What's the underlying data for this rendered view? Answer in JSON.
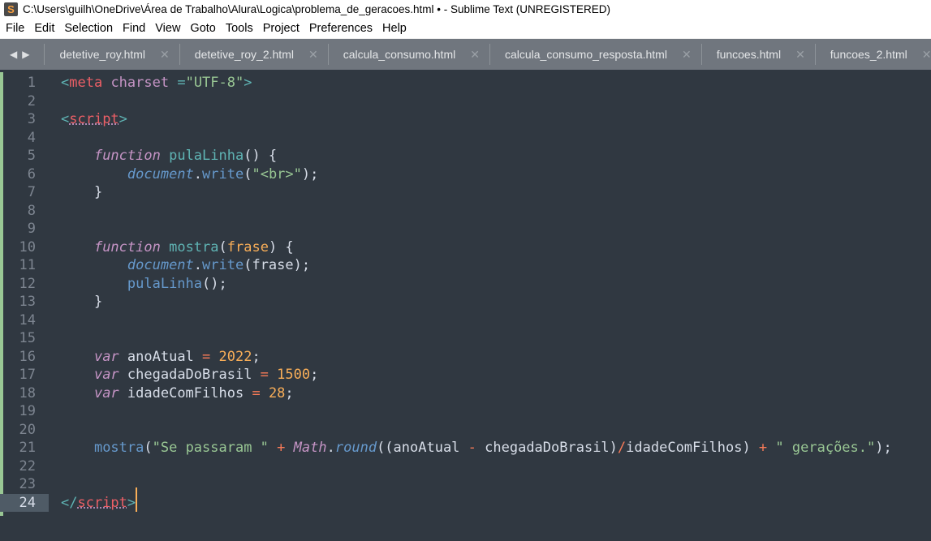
{
  "window": {
    "title": "C:\\Users\\guilh\\OneDrive\\Área de Trabalho\\Alura\\Logica\\problema_de_geracoes.html • - Sublime Text (UNREGISTERED)"
  },
  "menu": [
    "File",
    "Edit",
    "Selection",
    "Find",
    "View",
    "Goto",
    "Tools",
    "Project",
    "Preferences",
    "Help"
  ],
  "tabs": [
    "detetive_roy.html",
    "detetive_roy_2.html",
    "calcula_consumo.html",
    "calcula_consumo_resposta.html",
    "funcoes.html",
    "funcoes_2.html",
    "faz_p"
  ],
  "colors": {
    "background": "#303841",
    "tag": "#ec5f66",
    "string": "#99c794",
    "keyword": "#c594c5",
    "number": "#f9ae58",
    "caret": "#f9ae58"
  },
  "current_line": 24,
  "code": [
    [
      [
        "pu",
        "<"
      ],
      [
        "tg",
        "meta"
      ],
      [
        "",
        ""
      ],
      [
        "at",
        " charset"
      ],
      [
        "pu",
        " ="
      ],
      [
        "st",
        "\"UTF-8\""
      ],
      [
        "pu",
        ">"
      ]
    ],
    [],
    [
      [
        "pu",
        "<"
      ],
      [
        "tg ul",
        "script"
      ],
      [
        "pu",
        ">"
      ]
    ],
    [],
    [
      [
        "",
        "    "
      ],
      [
        "kw",
        "function"
      ],
      [
        "",
        " "
      ],
      [
        "fn",
        "pulaLinha"
      ],
      [
        "",
        "() {"
      ]
    ],
    [
      [
        "",
        "        "
      ],
      [
        "it",
        "document"
      ],
      [
        "",
        "."
      ],
      [
        "cl",
        "write"
      ],
      [
        "",
        "("
      ],
      [
        "st",
        "\"<br>\""
      ],
      [
        "",
        ");"
      ]
    ],
    [
      [
        "",
        "    }"
      ]
    ],
    [],
    [],
    [
      [
        "",
        "    "
      ],
      [
        "kw",
        "function"
      ],
      [
        "",
        " "
      ],
      [
        "fn",
        "mostra"
      ],
      [
        "",
        "("
      ],
      [
        "pa",
        "frase"
      ],
      [
        "",
        ") {"
      ]
    ],
    [
      [
        "",
        "        "
      ],
      [
        "it",
        "document"
      ],
      [
        "",
        "."
      ],
      [
        "cl",
        "write"
      ],
      [
        "",
        "(frase);"
      ]
    ],
    [
      [
        "",
        "        "
      ],
      [
        "cl",
        "pulaLinha"
      ],
      [
        "",
        "();"
      ]
    ],
    [
      [
        "",
        "    }"
      ]
    ],
    [],
    [],
    [
      [
        "",
        "    "
      ],
      [
        "kw",
        "var"
      ],
      [
        "",
        " anoAtual "
      ],
      [
        "op",
        "="
      ],
      [
        "",
        " "
      ],
      [
        "nu",
        "2022"
      ],
      [
        "",
        ";"
      ]
    ],
    [
      [
        "",
        "    "
      ],
      [
        "kw",
        "var"
      ],
      [
        "",
        " chegadaDoBrasil "
      ],
      [
        "op",
        "="
      ],
      [
        "",
        " "
      ],
      [
        "nu",
        "1500"
      ],
      [
        "",
        ";"
      ]
    ],
    [
      [
        "",
        "    "
      ],
      [
        "kw",
        "var"
      ],
      [
        "",
        " idadeComFilhos "
      ],
      [
        "op",
        "="
      ],
      [
        "",
        " "
      ],
      [
        "nu",
        "28"
      ],
      [
        "",
        ";"
      ]
    ],
    [],
    [],
    [
      [
        "",
        "    "
      ],
      [
        "cl",
        "mostra"
      ],
      [
        "",
        "("
      ],
      [
        "st",
        "\"Se passaram \""
      ],
      [
        "",
        " "
      ],
      [
        "op",
        "+"
      ],
      [
        "",
        " "
      ],
      [
        "mi",
        "Math"
      ],
      [
        "",
        "."
      ],
      [
        "it",
        "round"
      ],
      [
        "",
        "((anoAtual "
      ],
      [
        "op",
        "-"
      ],
      [
        "",
        " chegadaDoBrasil)"
      ],
      [
        "op",
        "/"
      ],
      [
        "",
        "idadeComFilhos) "
      ],
      [
        "op",
        "+"
      ],
      [
        "",
        " "
      ],
      [
        "st",
        "\" gerações.\""
      ],
      [
        "",
        ");"
      ]
    ],
    [],
    [],
    [
      [
        "pu",
        "</"
      ],
      [
        "tg ul",
        "script"
      ],
      [
        "pu",
        ">"
      ]
    ]
  ]
}
